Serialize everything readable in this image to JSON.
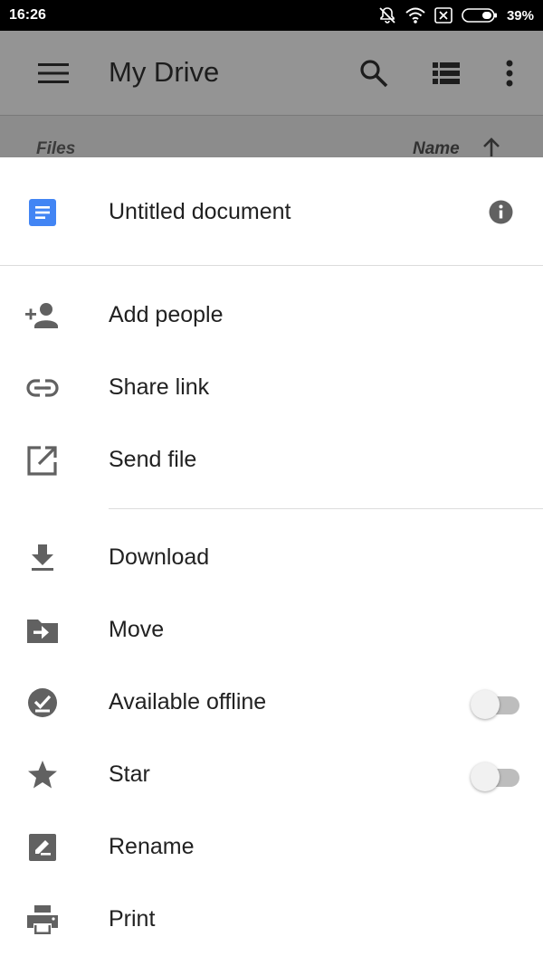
{
  "status_bar": {
    "time": "16:26",
    "battery_percent": "39%",
    "icons": [
      "silent-icon",
      "wifi-icon",
      "sim-off-icon",
      "battery-icon"
    ]
  },
  "app_bar": {
    "title": "My Drive",
    "icons": [
      "menu-icon",
      "search-icon",
      "list-view-icon",
      "more-vert-icon"
    ]
  },
  "files_header": {
    "section_label": "Files",
    "sort_label": "Name",
    "sort_icon": "arrow-up-icon"
  },
  "sheet": {
    "document": {
      "title": "Untitled document",
      "icon": "google-docs-icon",
      "info_icon": "info-icon"
    },
    "share_actions": [
      {
        "label": "Add people",
        "icon": "add-person-icon"
      },
      {
        "label": "Share link",
        "icon": "link-icon"
      },
      {
        "label": "Send file",
        "icon": "open-in-new-icon"
      }
    ],
    "file_actions": [
      {
        "label": "Download",
        "icon": "download-icon"
      },
      {
        "label": "Move",
        "icon": "move-to-folder-icon"
      },
      {
        "label": "Available offline",
        "icon": "offline-check-icon",
        "toggle": false
      },
      {
        "label": "Star",
        "icon": "star-icon",
        "toggle": false
      },
      {
        "label": "Rename",
        "icon": "rename-icon"
      },
      {
        "label": "Print",
        "icon": "print-icon"
      }
    ]
  },
  "colors": {
    "docs_blue": "#4285f4",
    "icon_gray": "#616161",
    "text_primary": "#212121",
    "toggle_off_track": "#bdbdbd"
  }
}
